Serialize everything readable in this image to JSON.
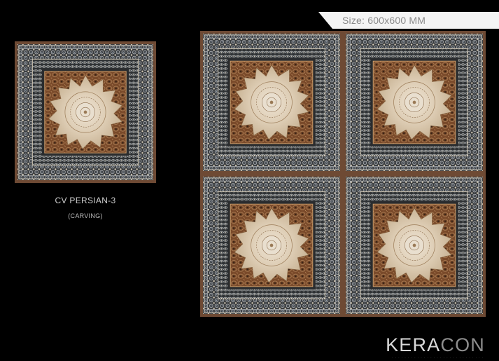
{
  "size_label": "Size: 600x600 MM",
  "product": {
    "name": "CV PERSIAN-3",
    "finish": "(CARVING)"
  },
  "brand": {
    "logo_text_light": "KERA",
    "logo_text_dim": "CON"
  },
  "colors": {
    "background": "#000000",
    "tile_border": "#6e4a34",
    "tile_outer": "#3b3e40",
    "tile_center": "#7a4a2a",
    "medallion": "#e0d2bd",
    "pattern_light": "#cdd0d0"
  }
}
